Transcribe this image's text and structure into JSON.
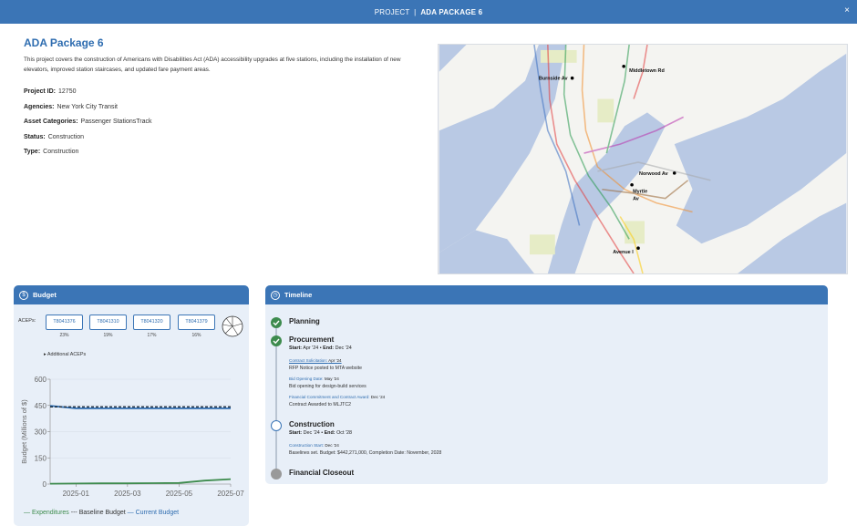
{
  "header": {
    "prefix": "PROJECT",
    "separator": "|",
    "name": "ADA PACKAGE 6",
    "close_glyph": "×"
  },
  "project": {
    "title": "ADA Package 6",
    "description": "This project covers the construction of Americans with Disabilities Act (ADA) accessibility upgrades at five stations, including the installation of new elevators, improved station staircases, and updated fare payment areas.",
    "fields": [
      {
        "label": "Project ID:",
        "value": "12750"
      },
      {
        "label": "Agencies:",
        "value": "New York City Transit"
      },
      {
        "label": "Asset Categories:",
        "value": "Passenger StationsTrack"
      },
      {
        "label": "Status:",
        "value": "Construction"
      },
      {
        "label": "Type:",
        "value": "Construction"
      }
    ]
  },
  "map": {
    "stations": [
      {
        "name": "Middletown Rd"
      },
      {
        "name": "Burnside Av"
      },
      {
        "name": "Norwood Av"
      },
      {
        "name": "Myrtle Av"
      },
      {
        "name": "Avenue I"
      }
    ]
  },
  "budget": {
    "title": "Budget",
    "icon_glyph": "$",
    "aceps_label": "ACEPs:",
    "aceps": [
      {
        "id": "T8041376",
        "pct": "23%"
      },
      {
        "id": "T8041310",
        "pct": "19%"
      },
      {
        "id": "T8041320",
        "pct": "17%"
      },
      {
        "id": "T8041379",
        "pct": "16%"
      }
    ],
    "additional": "Additional ACEPs",
    "legend": {
      "expenditures": "— Expenditures",
      "baseline": "--- Baseline Budget",
      "current": "— Current Budget"
    },
    "colors": {
      "expenditures": "#3d8b4d",
      "baseline": "#1b2a3a",
      "current": "#2f6db0"
    }
  },
  "chart_data": {
    "type": "line",
    "ylabel": "Budget (Millions of $)",
    "xlabel": "",
    "ylim": [
      0,
      600
    ],
    "yticks": [
      "0",
      "150",
      "300",
      "450",
      "600"
    ],
    "xticks": [
      "2025-01",
      "2025-03",
      "2025-05",
      "2025-07"
    ],
    "x_range": [
      "2024-12",
      "2025-07"
    ],
    "series": [
      {
        "name": "Expenditures",
        "x": [
          "2024-12",
          "2025-01",
          "2025-02",
          "2025-03",
          "2025-04",
          "2025-05",
          "2025-06",
          "2025-07"
        ],
        "values": [
          2,
          3,
          4,
          4,
          5,
          6,
          20,
          28
        ]
      },
      {
        "name": "Baseline Budget",
        "x": [
          "2024-12",
          "2025-07"
        ],
        "values": [
          442,
          442
        ]
      },
      {
        "name": "Current Budget",
        "x": [
          "2024-12",
          "2025-01",
          "2025-07"
        ],
        "values": [
          448,
          433,
          433
        ]
      }
    ]
  },
  "timeline": {
    "title": "Timeline",
    "icon_glyph": "◷",
    "phases": [
      {
        "name": "Planning",
        "state": "done"
      },
      {
        "name": "Procurement",
        "state": "done",
        "start_label": "Start:",
        "start": "Apr '24",
        "sep": "•",
        "end_label": "End:",
        "end": "Dec '24",
        "events": [
          {
            "label": "Contract Solicitation:",
            "date": "Apr '24",
            "desc": "RFP Notice posted to MTA website",
            "link": true
          },
          {
            "label": "Bid Opening Date:",
            "date": "May '24",
            "desc": "Bid opening for design-build services",
            "link": false
          },
          {
            "label": "Financial Commitment and Contract Award:",
            "date": "Dec '24",
            "desc": "Contract Awarded to MLJTC2",
            "link": false
          }
        ]
      },
      {
        "name": "Construction",
        "state": "current",
        "start_label": "Start:",
        "start": "Dec '24",
        "sep": "•",
        "end_label": "End:",
        "end": "Oct '28",
        "events": [
          {
            "label": "Construction Start:",
            "date": "Dec '24",
            "desc": "Baselines set. Budget: $442,271,000, Completion Date: November, 2028",
            "link": false
          }
        ]
      },
      {
        "name": "Financial Closeout",
        "state": "future"
      }
    ]
  }
}
